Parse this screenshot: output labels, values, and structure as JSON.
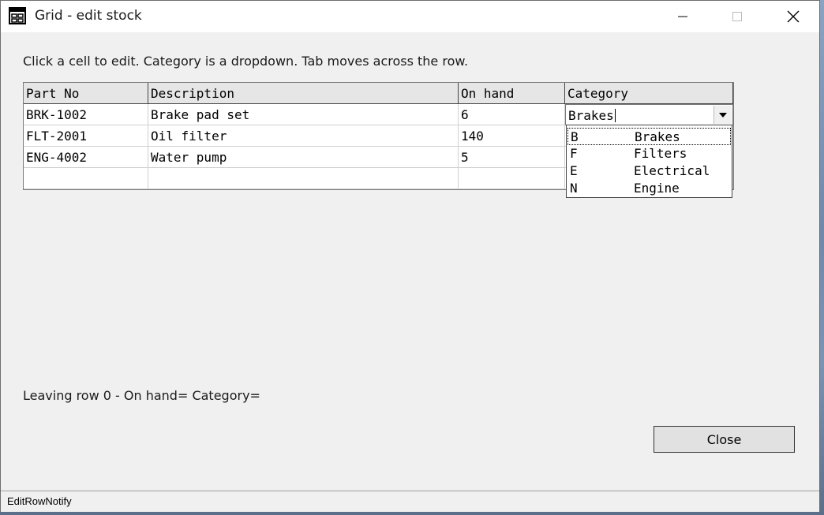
{
  "window": {
    "title": "Grid - edit stock",
    "icon": "grid-window-icon"
  },
  "instructions": "Click a cell to edit. Category is a dropdown. Tab moves across the row.",
  "grid": {
    "columns": [
      "Part No",
      "Description",
      "On hand",
      "Category"
    ],
    "rows": [
      {
        "part_no": "BRK-1002",
        "description": "Brake pad set",
        "on_hand": "6",
        "category": "Brakes"
      },
      {
        "part_no": "FLT-2001",
        "description": "Oil filter",
        "on_hand": "140",
        "category": ""
      },
      {
        "part_no": "ENG-4002",
        "description": "Water pump",
        "on_hand": "5",
        "category": ""
      }
    ],
    "editor": {
      "value": "Brakes"
    }
  },
  "dropdown": {
    "options": [
      {
        "code": "B",
        "name": "Brakes"
      },
      {
        "code": "F",
        "name": "Filters"
      },
      {
        "code": "E",
        "name": "Electrical"
      },
      {
        "code": "N",
        "name": "Engine"
      }
    ]
  },
  "status_message": "Leaving row 0 - On hand= Category=",
  "close_label": "Close",
  "statusbar_text": "EditRowNotify"
}
